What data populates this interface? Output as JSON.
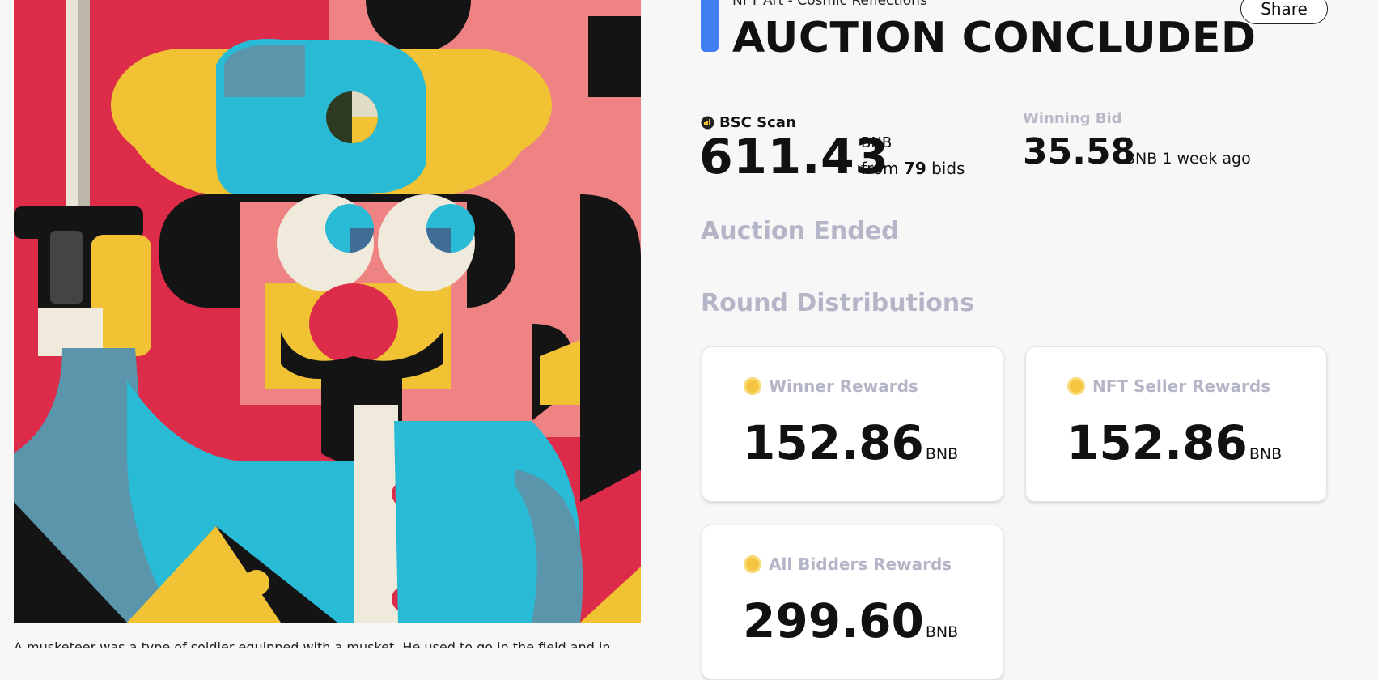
{
  "nft": {
    "subtitle": "NFT Art - Cosmic Reflections",
    "description": "A musketeer was a type of soldier equipped with a musket. He used to go in the field and in"
  },
  "auction": {
    "title": "AUCTION CONCLUDED",
    "share_label": "Share",
    "scan_label": "BSC Scan",
    "total_value": "611.43",
    "total_unit": "BNB",
    "from_prefix": "from",
    "bid_count": "79",
    "bids_suffix": "bids",
    "winning_bid_label": "Winning Bid",
    "winning_bid_value": "35.58",
    "winning_bid_meta": "BNB 1 week ago",
    "status": "Auction Ended"
  },
  "distributions": {
    "heading": "Round Distributions",
    "cards": [
      {
        "label": "Winner Rewards",
        "value": "152.86",
        "unit": "BNB"
      },
      {
        "label": "NFT Seller Rewards",
        "value": "152.86",
        "unit": "BNB"
      },
      {
        "label": "All Bidders Rewards",
        "value": "299.60",
        "unit": "BNB"
      }
    ]
  },
  "colors": {
    "accent": "#3f7ff2",
    "muted_heading": "#b5b5c8",
    "coin": "#f5c542"
  }
}
